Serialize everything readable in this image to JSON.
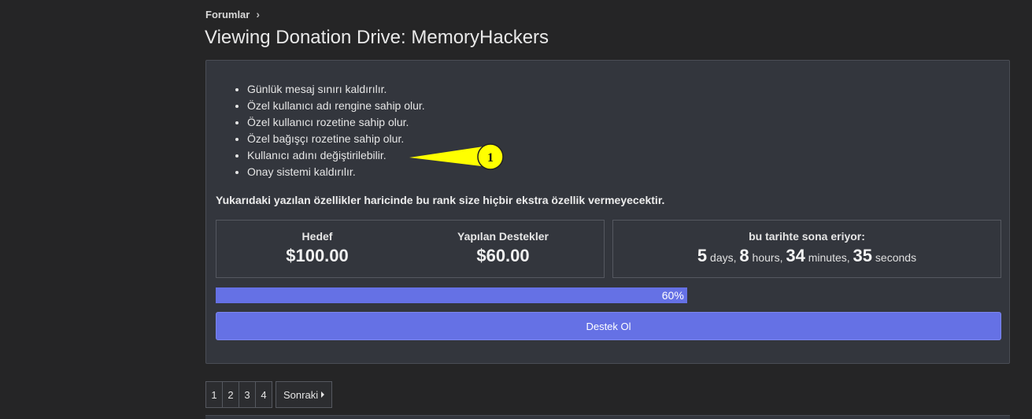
{
  "breadcrumb": {
    "item": "Forumlar"
  },
  "page": {
    "title": "Viewing Donation Drive: MemoryHackers"
  },
  "perks": [
    "Günlük mesaj sınırı kaldırılır.",
    "Özel kullanıcı adı rengine sahip olur.",
    "Özel kullanıcı rozetine sahip olur.",
    "Özel bağışçı rozetine sahip olur.",
    "Kullanıcı adını değiştirilebilir.",
    "Onay sistemi kaldırılır."
  ],
  "note": "Yukarıdaki yazılan özellikler haricinde bu rank size hiçbir ekstra özellik vermeyecektir.",
  "goal": {
    "label": "Hedef",
    "value": "$100.00"
  },
  "raised": {
    "label": "Yapılan Destekler",
    "value": "$60.00"
  },
  "ends": {
    "label": "bu tarihte sona eriyor:",
    "days": "5",
    "days_unit": "days,",
    "hours": "8",
    "hours_unit": "hours,",
    "minutes": "34",
    "minutes_unit": "minutes,",
    "seconds": "35",
    "seconds_unit": "seconds"
  },
  "progress": {
    "percent": 60,
    "label": "60%"
  },
  "donate_button": "Destek Ol",
  "pagination": {
    "pages": [
      "1",
      "2",
      "3",
      "4"
    ],
    "next": "Sonraki"
  },
  "annotation": {
    "number": "1"
  },
  "colors": {
    "accent": "#6571e5",
    "callout": "#ffff00"
  }
}
